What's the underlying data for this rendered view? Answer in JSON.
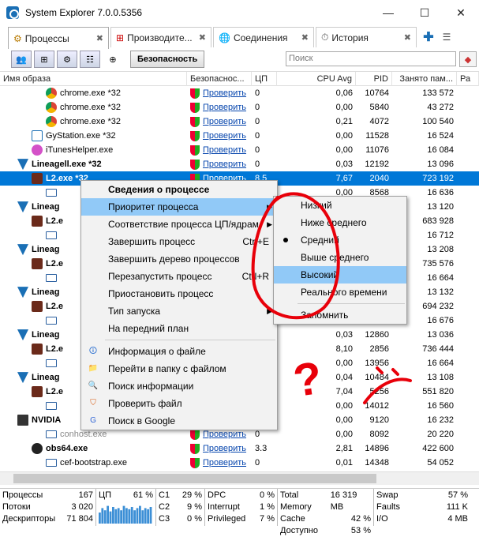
{
  "window": {
    "title": "System Explorer 7.0.0.5356",
    "minimize": "—",
    "maximize": "☐",
    "close": "✕"
  },
  "tabs": [
    {
      "label": "Процессы",
      "close": "✖",
      "icon": "⚙"
    },
    {
      "label": "Производите...",
      "close": "✖",
      "icon": "⊞"
    },
    {
      "label": "Соединения",
      "close": "✖",
      "icon": "🌐"
    },
    {
      "label": "История",
      "close": "✖",
      "icon": "⏱"
    }
  ],
  "tab_add": "✚",
  "tab_menu": "☰",
  "toolbar": {
    "security_label": "Безопасность",
    "search_placeholder": "Поиск"
  },
  "columns": [
    "Имя образа",
    "Безопаснос...",
    "ЦП",
    "CPU Avg",
    "PID",
    "Занято пам...",
    "Ра"
  ],
  "rows": [
    {
      "name": "chrome.exe *32",
      "link": "Проверить",
      "cpu": "0",
      "avg": "0,06",
      "pid": "10764",
      "mem": "133 572"
    },
    {
      "name": "chrome.exe *32",
      "link": "Проверить",
      "cpu": "0",
      "avg": "0,00",
      "pid": "5840",
      "mem": "43 272"
    },
    {
      "name": "chrome.exe *32",
      "link": "Проверить",
      "cpu": "0",
      "avg": "0,21",
      "pid": "4072",
      "mem": "100 540"
    },
    {
      "name": "GyStation.exe *32",
      "link": "Проверить",
      "cpu": "0",
      "avg": "0,00",
      "pid": "11528",
      "mem": "16 524"
    },
    {
      "name": "iTunesHelper.exe",
      "link": "Проверить",
      "cpu": "0",
      "avg": "0,00",
      "pid": "11076",
      "mem": "16 084"
    },
    {
      "name": "Lineagell.exe *32",
      "link": "Проверить",
      "cpu": "0",
      "avg": "0,03",
      "pid": "12192",
      "mem": "13 096"
    },
    {
      "name": "L2.exe *32",
      "link": "Проверить",
      "cpu": "8.5",
      "avg": "7,67",
      "pid": "2040",
      "mem": "723 192"
    },
    {
      "name": "",
      "link": "",
      "cpu": "",
      "avg": "0,00",
      "pid": "8568",
      "mem": "16 636"
    },
    {
      "name": "Lineag",
      "link": "",
      "cpu": "",
      "avg": "",
      "pid": "",
      "mem": "13 120"
    },
    {
      "name": "L2.e",
      "link": "",
      "cpu": "",
      "avg": "",
      "pid": "",
      "mem": "683 928"
    },
    {
      "name": "",
      "link": "",
      "cpu": "",
      "avg": "",
      "pid": "",
      "mem": "16 712"
    },
    {
      "name": "Lineag",
      "link": "",
      "cpu": "",
      "avg": "",
      "pid": "",
      "mem": "13 208"
    },
    {
      "name": "L2.e",
      "link": "",
      "cpu": "",
      "avg": "",
      "pid": "",
      "mem": "735 576"
    },
    {
      "name": "",
      "link": "",
      "cpu": "",
      "avg": "",
      "pid": "",
      "mem": "16 664"
    },
    {
      "name": "Lineag",
      "link": "",
      "cpu": "",
      "avg": "",
      "pid": "",
      "mem": "13 132"
    },
    {
      "name": "L2.e",
      "link": "",
      "cpu": "",
      "avg": "",
      "pid": "",
      "mem": "694 232"
    },
    {
      "name": "",
      "link": "",
      "cpu": "",
      "avg": "",
      "pid": "",
      "mem": "16 676"
    },
    {
      "name": "Lineag",
      "link": "",
      "cpu": "",
      "avg": "0,03",
      "pid": "12860",
      "mem": "13 036"
    },
    {
      "name": "L2.e",
      "link": "",
      "cpu": "",
      "avg": "8,10",
      "pid": "2856",
      "mem": "736 444"
    },
    {
      "name": "",
      "link": "",
      "cpu": "",
      "avg": "0,00",
      "pid": "13956",
      "mem": "16 664"
    },
    {
      "name": "Lineag",
      "link": "",
      "cpu": "",
      "avg": "0,04",
      "pid": "10484",
      "mem": "13 108"
    },
    {
      "name": "L2.e",
      "link": "",
      "cpu": "",
      "avg": "7,04",
      "pid": "5256",
      "mem": "551 820"
    },
    {
      "name": "",
      "link": "",
      "cpu": "",
      "avg": "0,00",
      "pid": "14012",
      "mem": "16 560"
    },
    {
      "name": "NVIDIA",
      "link": "",
      "cpu": "",
      "avg": "0,00",
      "pid": "9120",
      "mem": "16 232"
    },
    {
      "name": "conhost.exe",
      "link": "Проверить",
      "cpu": "0",
      "avg": "0,00",
      "pid": "8092",
      "mem": "20 220"
    },
    {
      "name": "obs64.exe",
      "link": "Проверить",
      "cpu": "3.3",
      "avg": "2,81",
      "pid": "14896",
      "mem": "422 600"
    },
    {
      "name": "cef-bootstrap.exe",
      "link": "Проверить",
      "cpu": "0",
      "avg": "0,01",
      "pid": "14348",
      "mem": "54 052"
    }
  ],
  "context_menu": {
    "items": [
      {
        "label": "Сведения о процессе",
        "shortcut": "",
        "bold": true
      },
      {
        "label": "Приоритет процесса",
        "shortcut": "",
        "submenu": "▶"
      },
      {
        "label": "Соответствие процесса ЦП/ядрам",
        "shortcut": "",
        "submenu": "▶"
      },
      {
        "label": "Завершить процесс",
        "shortcut": "Ctrl+E"
      },
      {
        "label": "Завершить дерево процессов",
        "shortcut": ""
      },
      {
        "label": "Перезапустить процесс",
        "shortcut": "Ctrl+R"
      },
      {
        "label": "Приостановить процесс",
        "shortcut": ""
      },
      {
        "label": "Тип запуска",
        "shortcut": "",
        "submenu": "▶"
      },
      {
        "label": "На передний план",
        "shortcut": ""
      },
      {
        "label": "Информация о файле",
        "shortcut": ""
      },
      {
        "label": "Перейти в папку с файлом",
        "shortcut": ""
      },
      {
        "label": "Поиск информации",
        "shortcut": ""
      },
      {
        "label": "Проверить файл",
        "shortcut": ""
      },
      {
        "label": "Поиск в Google",
        "shortcut": ""
      }
    ]
  },
  "priority_menu": {
    "items": [
      "Низкий",
      "Ниже среднего",
      "Средний",
      "Выше среднего",
      "Высокий",
      "Реального времени",
      "Запомнить"
    ],
    "selected": "Средний",
    "highlighted": "Высокий"
  },
  "annotation": {
    "question_mark": "?",
    "stroke_color": "#e8000a"
  },
  "status": {
    "processes_label": "Процессы",
    "processes": "167",
    "threads_label": "Потоки",
    "threads": "3 020",
    "handles_label": "Дескрипторы",
    "handles": "71 804",
    "cpu_label": "ЦП",
    "cpu": "61 %",
    "c1_label": "C1",
    "c1": "29 %",
    "c2_label": "C2",
    "c2": "9 %",
    "c3_label": "C3",
    "c3": "0 %",
    "dpc_label": "DPC",
    "dpc": "0 %",
    "interrupt_label": "Interrupt",
    "interrupt": "1 %",
    "privileged_label": "Privileged",
    "privileged": "7 %",
    "totalmem_label": "Total Memory",
    "totalmem": "16 319 MB",
    "cache_label": "Cache",
    "cache": "42 %",
    "avail_label": "Доступно",
    "avail": "53 %",
    "swap_label": "Swap",
    "swap": "57 %",
    "faults_label": "Faults",
    "faults": "111 K",
    "io_label": "I/O",
    "io": "4 MB",
    "cpu_history": [
      0.5,
      0.7,
      0.6,
      0.8,
      0.55,
      0.75,
      0.65,
      0.7,
      0.6,
      0.8,
      0.7,
      0.65,
      0.75,
      0.6,
      0.7,
      0.8,
      0.6,
      0.7,
      0.65,
      0.75
    ]
  }
}
